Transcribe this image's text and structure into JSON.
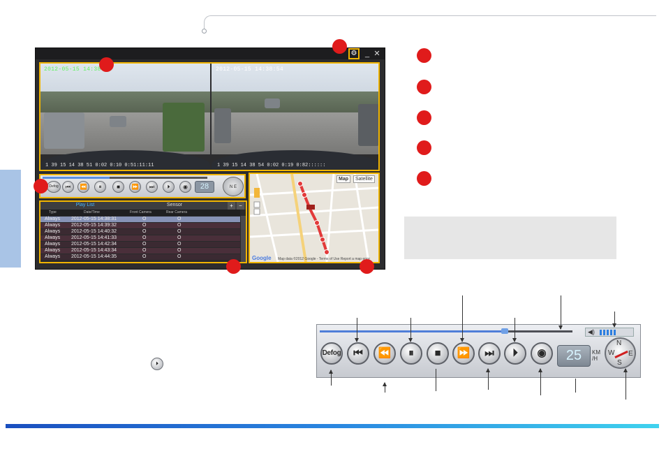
{
  "window": {
    "gear_icon": "⚙",
    "minimize_label": "_",
    "close_label": "✕"
  },
  "video_left": {
    "timestamp": "2012-05-15 14:38:52",
    "overlay": "1 39 15 14 38 51 0:02 0:10 0:51:11:11"
  },
  "video_right": {
    "timestamp": "2012-05-15 14:38:54",
    "overlay": "1 39 15 14 38 54 0:02 0:19 0:82::::::"
  },
  "mini_controls": {
    "defog": "Defog",
    "speed": "28",
    "compass": "N E"
  },
  "playlist": {
    "tabs": [
      "Play List",
      "Sensor"
    ],
    "add_label": "+",
    "remove_label": "−",
    "headers": [
      "Type",
      "Date/Time",
      "Front Camera",
      "Rear Camera"
    ],
    "rows": [
      [
        "Always",
        "2012-05-15 14:38:31",
        "O",
        "O"
      ],
      [
        "Always",
        "2012-05-15 14:39:32",
        "O",
        "O"
      ],
      [
        "Always",
        "2012-05-15 14:40:32",
        "O",
        "O"
      ],
      [
        "Always",
        "2012-05-15 14:41:33",
        "O",
        "O"
      ],
      [
        "Always",
        "2012-05-15 14:42:34",
        "O",
        "O"
      ],
      [
        "Always",
        "2012-05-15 14:43:34",
        "O",
        "O"
      ],
      [
        "Always",
        "2012-05-15 14:44:35",
        "O",
        "O"
      ]
    ]
  },
  "map": {
    "map_label": "Map",
    "satellite_label": "Satellite",
    "footer": "Map data ©2012 Google - Terms of Use   Report a map error",
    "google": "Google"
  },
  "control_bar": {
    "defog": "Defog",
    "speed": "25",
    "kmh": "KM /H",
    "compass_n": "N",
    "compass_w": "W",
    "compass_e": "E",
    "compass_s": "S",
    "progress": 0.73,
    "volume_level": 0.9
  },
  "colors": {
    "accent_outline": "#f0b400",
    "callout_red": "#e01b1b",
    "side_tab": "#a9c4e6"
  }
}
